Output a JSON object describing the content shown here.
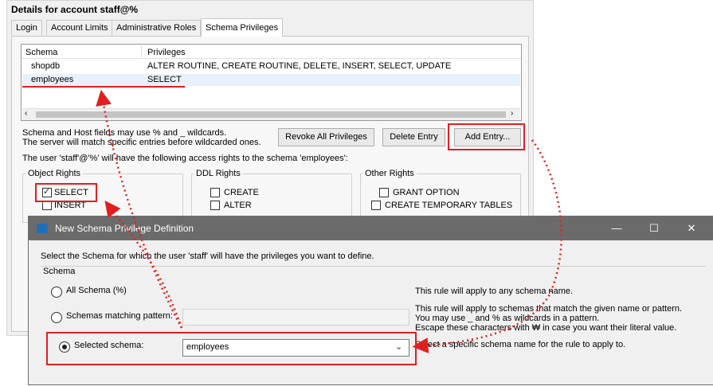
{
  "details": {
    "title": "Details for account staff@%",
    "tabs": [
      "Login",
      "Account Limits",
      "Administrative Roles",
      "Schema Privileges"
    ],
    "active_tab": "Schema Privileges",
    "columns": [
      "Schema",
      "Privileges"
    ],
    "rows": [
      {
        "schema": "shopdb",
        "privileges": "ALTER ROUTINE, CREATE ROUTINE, DELETE, INSERT, SELECT, UPDATE"
      },
      {
        "schema": "employees",
        "privileges": "SELECT"
      }
    ],
    "hint_line1": "Schema and Host fields may use % and _ wildcards.",
    "hint_line2": "The server will match specific entries before wildcarded ones.",
    "revoke_button": "Revoke All Privileges",
    "delete_button": "Delete Entry",
    "add_button": "Add Entry...",
    "access_text": "The user 'staff'@'%' will have the following access rights to the schema 'employees':",
    "object_rights": {
      "title": "Object Rights",
      "items": [
        "SELECT",
        "INSERT"
      ],
      "checked": [
        true,
        false
      ]
    },
    "ddl_rights": {
      "title": "DDL Rights",
      "items": [
        "CREATE",
        "ALTER"
      ]
    },
    "other_rights": {
      "title": "Other Rights",
      "items": [
        "GRANT OPTION",
        "CREATE TEMPORARY TABLES"
      ]
    }
  },
  "dialog": {
    "title": "New Schema Privilege Definition",
    "intro": "Select the Schema for which the user 'staff' will have the privileges you want to define.",
    "group_label": "Schema",
    "options": [
      {
        "label": "All Schema (%)",
        "desc": "This rule will apply to any schema name.",
        "selected": false
      },
      {
        "label": "Schemas matching pattern:",
        "desc_line1": "This rule will apply to schemas that match the given name or pattern.",
        "desc_line2": "You may use _ and % as wildcards in a pattern.",
        "desc_line3": "Escape these characters with ₩ in case you want their literal value.",
        "selected": false
      },
      {
        "label": "Selected schema:",
        "value": "employees",
        "desc": "Select a specific schema name for the rule to apply to.",
        "selected": true
      }
    ],
    "window_buttons": {
      "minimize": "—",
      "maximize": "☐",
      "close": "✕"
    }
  },
  "colors": {
    "highlight": "#e02020",
    "titlebar": "#6b6b6b"
  }
}
